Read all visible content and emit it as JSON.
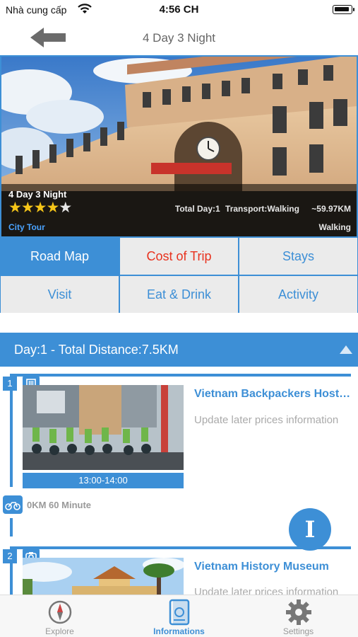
{
  "status_bar": {
    "carrier": "Nhà cung cấp",
    "time": "4:56 CH"
  },
  "nav": {
    "title": "4 Day 3 Night",
    "back_icon": "arrow-left-icon"
  },
  "hero": {
    "title": "4 Day 3 Night",
    "rating": 4,
    "rating_max": 5,
    "category": "City Tour",
    "total_day": "Total Day:1",
    "transport": "Transport:Walking",
    "distance": "~59.97KM",
    "mode": "Walking"
  },
  "tabs": [
    {
      "label": "Road Map",
      "state": "active"
    },
    {
      "label": "Cost of Trip",
      "state": "highlight"
    },
    {
      "label": "Stays",
      "state": "normal"
    },
    {
      "label": "Visit",
      "state": "normal"
    },
    {
      "label": "Eat & Drink",
      "state": "normal"
    },
    {
      "label": "Activity",
      "state": "normal"
    }
  ],
  "day_section": {
    "header": "Day:1 - Total Distance:7.5KM",
    "collapse_icon": "caret-up-icon"
  },
  "stops": [
    {
      "number": "1",
      "type_icon": "building-icon",
      "title": "Vietnam Backpackers Hostels",
      "description": "Update later prices information",
      "time": "13:00-14:00"
    },
    {
      "number": "2",
      "type_icon": "camera-icon",
      "title": "Vietnam History Museum",
      "description": "Update later prices information"
    }
  ],
  "transit": {
    "icon": "motorbike-icon",
    "text": "0KM 60 Minute"
  },
  "fab": {
    "label": "I",
    "icon": "info-icon"
  },
  "tabbar": [
    {
      "label": "Explore",
      "icon": "compass-icon",
      "active": false
    },
    {
      "label": "Informations",
      "icon": "document-icon",
      "active": true
    },
    {
      "label": "Settings",
      "icon": "gear-icon",
      "active": false
    }
  ],
  "colors": {
    "primary": "#3d8fd6",
    "highlight": "#e8321e",
    "star": "#f5c518"
  }
}
